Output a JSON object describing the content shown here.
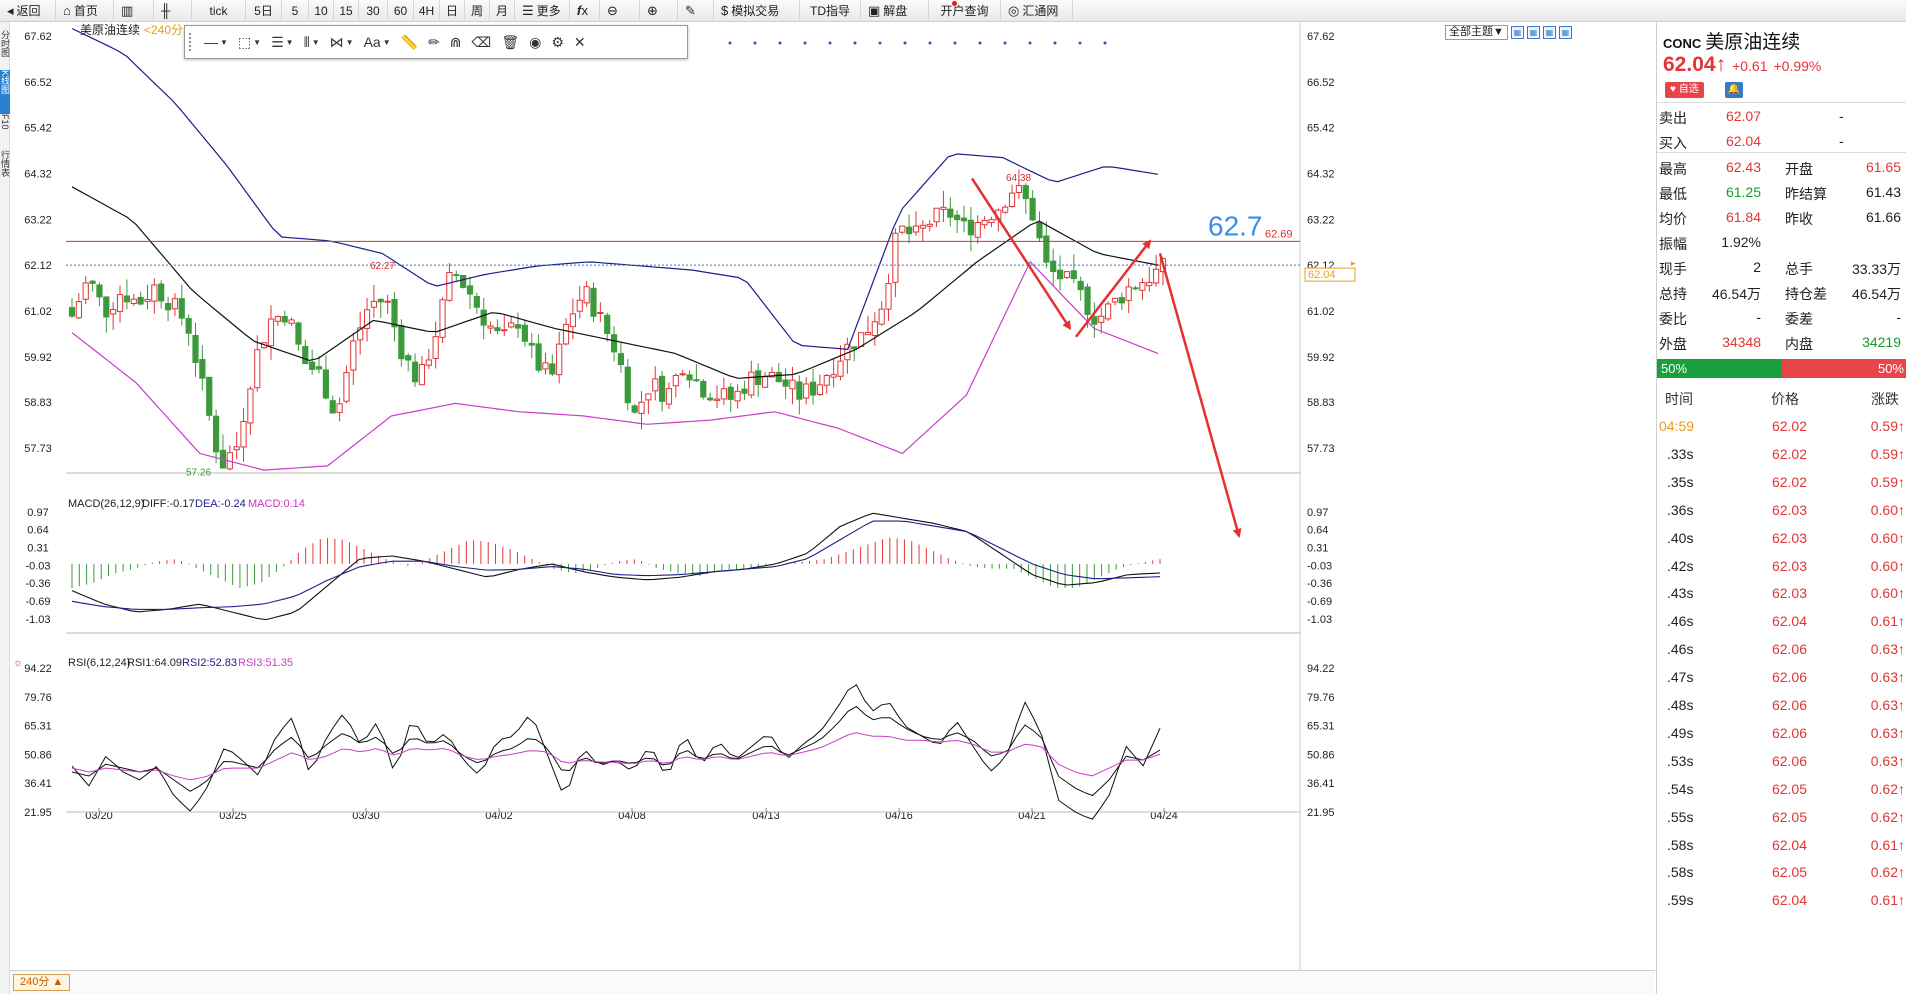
{
  "toolbar": [
    {
      "icon": "◂",
      "label": "返回",
      "name": "back-button"
    },
    {
      "icon": "⌂",
      "label": "首页",
      "name": "home-button"
    },
    {
      "icon": "▥",
      "label": "",
      "name": "bars-icon-button"
    },
    {
      "icon": "╫",
      "label": "",
      "name": "candles-icon-button"
    },
    {
      "icon": "",
      "label": "tick",
      "name": "period-tick"
    },
    {
      "icon": "",
      "label": "5日",
      "name": "period-5day"
    },
    {
      "icon": "",
      "label": "5",
      "name": "period-5"
    },
    {
      "icon": "",
      "label": "10",
      "name": "period-10"
    },
    {
      "icon": "",
      "label": "15",
      "name": "period-15"
    },
    {
      "icon": "",
      "label": "30",
      "name": "period-30"
    },
    {
      "icon": "",
      "label": "60",
      "name": "period-60"
    },
    {
      "icon": "",
      "label": "4H",
      "name": "period-4h"
    },
    {
      "icon": "",
      "label": "日",
      "name": "period-day"
    },
    {
      "icon": "",
      "label": "周",
      "name": "period-week"
    },
    {
      "icon": "",
      "label": "月",
      "name": "period-month"
    },
    {
      "icon": "☰",
      "label": "更多",
      "name": "more-button"
    },
    {
      "icon": "𝒇x",
      "label": "",
      "name": "formula-button"
    },
    {
      "icon": "⊖",
      "label": "",
      "name": "zoom-out-button"
    },
    {
      "icon": "⊕",
      "label": "",
      "name": "zoom-in-button"
    },
    {
      "icon": "✎",
      "label": "",
      "name": "draw-button"
    },
    {
      "icon": "$",
      "label": "模拟交易",
      "name": "sim-trade-button"
    },
    {
      "icon": "",
      "label": "TD指导",
      "name": "td-guide-button"
    },
    {
      "icon": "▣",
      "label": "解盘",
      "name": "analysis-button"
    },
    {
      "icon": "",
      "label": "开户查询",
      "name": "account-query-button"
    },
    {
      "icon": "◎",
      "label": "汇通网",
      "name": "huitong-button"
    }
  ],
  "left_tabs": [
    "分时图",
    "K线图",
    "F10",
    "行情表"
  ],
  "chart_header": {
    "symbol": "美原油连续",
    "period": "<240分"
  },
  "theme": {
    "label": "全部主题▼"
  },
  "price_axis": [
    "67.62",
    "66.52",
    "65.42",
    "64.32",
    "63.22",
    "62.12",
    "61.02",
    "59.92",
    "58.83",
    "57.73"
  ],
  "current_price_tag": "62.04",
  "hline": {
    "value": "62.69",
    "annotation": "62.7"
  },
  "peak_labels": {
    "high": "64.38",
    "mid": "62.27",
    "low": "57.26"
  },
  "macd": {
    "title": "MACD(26,12,9)",
    "diff": "DIFF:-0.17",
    "dea": "DEA:-0.24",
    "macd": "MACD:0.14",
    "axis": [
      "0.97",
      "0.64",
      "0.31",
      "-0.03",
      "-0.36",
      "-0.69",
      "-1.03"
    ]
  },
  "rsi": {
    "title": "RSI(6,12,24)",
    "rsi1": "RSI1:64.09",
    "rsi2": "RSI2:52.83",
    "rsi3": "RSI3:51.35",
    "axis": [
      "94.22",
      "79.76",
      "65.31",
      "50.86",
      "36.41",
      "21.95"
    ]
  },
  "dates": [
    "03/20",
    "03/25",
    "03/30",
    "04/02",
    "04/08",
    "04/13",
    "04/16",
    "04/21",
    "04/24"
  ],
  "period_button": "240分 ▲",
  "colors": {
    "up": "#e23535",
    "down": "#3c9a3c",
    "boll_upper": "#1d1d8c",
    "boll_lower": "#c83ec8",
    "mid": "#111111",
    "hline": "#d33030",
    "arrow": "#e53030",
    "dea": "#1d1d8c",
    "rsi3": "#c83ec8"
  },
  "quote": {
    "code": "CONC",
    "name": "美原油连续",
    "price": "62.04",
    "arrow": "↑",
    "change": "+0.61",
    "pct": "+0.99%",
    "watch_label": "♥ 自选"
  },
  "book": [
    {
      "label": "卖出",
      "value": "62.07",
      "vol": "-"
    },
    {
      "label": "买入",
      "value": "62.04",
      "vol": "-"
    }
  ],
  "stats": [
    {
      "l1": "最高",
      "v1": "62.43",
      "c1": "red",
      "l2": "开盘",
      "v2": "61.65",
      "c2": "red"
    },
    {
      "l1": "最低",
      "v1": "61.25",
      "c1": "green",
      "l2": "昨结算",
      "v2": "61.43",
      "c2": "blk"
    },
    {
      "l1": "均价",
      "v1": "61.84",
      "c1": "red",
      "l2": "昨收",
      "v2": "61.66",
      "c2": "blk"
    },
    {
      "l1": "振幅",
      "v1": "1.92%",
      "c1": "blk",
      "l2": "",
      "v2": "",
      "c2": "blk"
    },
    {
      "l1": "现手",
      "v1": "2",
      "c1": "blk",
      "l2": "总手",
      "v2": "33.33万",
      "c2": "blk"
    },
    {
      "l1": "总持",
      "v1": "46.54万",
      "c1": "blk",
      "l2": "持仓差",
      "v2": "46.54万",
      "c2": "blk"
    },
    {
      "l1": "委比",
      "v1": "-",
      "c1": "blk",
      "l2": "委差",
      "v2": "-",
      "c2": "blk"
    },
    {
      "l1": "外盘",
      "v1": "34348",
      "c1": "red",
      "l2": "内盘",
      "v2": "34219",
      "c2": "green"
    }
  ],
  "ratio": {
    "buy": "50%",
    "sell": "50%"
  },
  "ticks_header": {
    "time": "时间",
    "price": "价格",
    "change": "涨跌"
  },
  "ticks": [
    {
      "t": "04:59",
      "p": "62.02",
      "c": "0.59"
    },
    {
      "t": ".33s",
      "p": "62.02",
      "c": "0.59"
    },
    {
      "t": ".35s",
      "p": "62.02",
      "c": "0.59"
    },
    {
      "t": ".36s",
      "p": "62.03",
      "c": "0.60"
    },
    {
      "t": ".40s",
      "p": "62.03",
      "c": "0.60"
    },
    {
      "t": ".42s",
      "p": "62.03",
      "c": "0.60"
    },
    {
      "t": ".43s",
      "p": "62.03",
      "c": "0.60"
    },
    {
      "t": ".46s",
      "p": "62.04",
      "c": "0.61"
    },
    {
      "t": ".46s",
      "p": "62.06",
      "c": "0.63"
    },
    {
      "t": ".47s",
      "p": "62.06",
      "c": "0.63"
    },
    {
      "t": ".48s",
      "p": "62.06",
      "c": "0.63"
    },
    {
      "t": ".49s",
      "p": "62.06",
      "c": "0.63"
    },
    {
      "t": ".53s",
      "p": "62.06",
      "c": "0.63"
    },
    {
      "t": ".54s",
      "p": "62.05",
      "c": "0.62"
    },
    {
      "t": ".55s",
      "p": "62.05",
      "c": "0.62"
    },
    {
      "t": ".58s",
      "p": "62.04",
      "c": "0.61"
    },
    {
      "t": ".58s",
      "p": "62.05",
      "c": "0.62"
    },
    {
      "t": ".59s",
      "p": "62.04",
      "c": "0.61"
    }
  ],
  "chart_data": {
    "type": "candlestick",
    "instrument": "美原油连续",
    "period": "240分",
    "yrange": [
      57.26,
      67.62
    ],
    "price_ticks": [
      67.62,
      66.52,
      65.42,
      64.32,
      63.22,
      62.12,
      61.02,
      59.92,
      58.83,
      57.73
    ],
    "x_labels": [
      "03/20",
      "03/25",
      "03/30",
      "04/02",
      "04/08",
      "04/13",
      "04/16",
      "04/21",
      "04/24"
    ],
    "close_path": [
      60.9,
      61.8,
      61.0,
      61.5,
      61.2,
      61.6,
      61.2,
      60.7,
      59.0,
      57.3,
      57.8,
      59.8,
      60.8,
      61.0,
      59.8,
      59.5,
      58.5,
      60.2,
      61.2,
      61.3,
      60.0,
      59.3,
      60.5,
      62.0,
      61.5,
      60.8,
      60.3,
      60.8,
      59.8,
      59.4,
      60.8,
      61.5,
      60.8,
      60.0,
      58.5,
      59.3,
      59.0,
      59.8,
      59.2,
      59.0,
      58.9,
      59.4,
      59.5,
      59.3,
      59.0,
      59.2,
      59.7,
      60.2,
      60.5,
      61.2,
      63.0,
      62.8,
      63.2,
      63.4,
      63.0,
      63.2,
      63.5,
      64.0,
      63.5,
      62.0,
      61.8,
      61.4,
      60.8,
      61.2,
      61.6,
      61.8,
      62.04
    ],
    "boll_upper_path": [
      67.8,
      67.2,
      66.0,
      64.5,
      62.8,
      62.7,
      62.4,
      61.6,
      61.9,
      62.1,
      62.2,
      62.1,
      62.0,
      61.8,
      60.2,
      60.1,
      63.4,
      64.8,
      64.7,
      64.1,
      64.5,
      64.3
    ],
    "boll_mid_path": [
      64.0,
      63.2,
      61.5,
      60.3,
      59.8,
      60.8,
      60.5,
      61.0,
      60.6,
      60.3,
      60.0,
      59.4,
      59.5,
      60.1,
      61.0,
      62.2,
      63.2,
      62.4,
      62.12
    ],
    "boll_lower_path": [
      60.5,
      59.3,
      57.6,
      57.2,
      57.3,
      58.5,
      58.8,
      58.6,
      58.5,
      58.3,
      58.4,
      58.6,
      58.2,
      57.6,
      59.0,
      62.2,
      60.6,
      60.0
    ],
    "hline": 62.69,
    "annotations": [
      "64.38",
      "62.27",
      "57.26",
      "62.7"
    ],
    "indicators": {
      "MACD(26,12,9)": {
        "DIFF": -0.17,
        "DEA": -0.24,
        "MACD": 0.14
      },
      "RSI(6,12,24)": {
        "RSI1": 64.09,
        "RSI2": 52.83,
        "RSI3": 51.35
      }
    }
  }
}
